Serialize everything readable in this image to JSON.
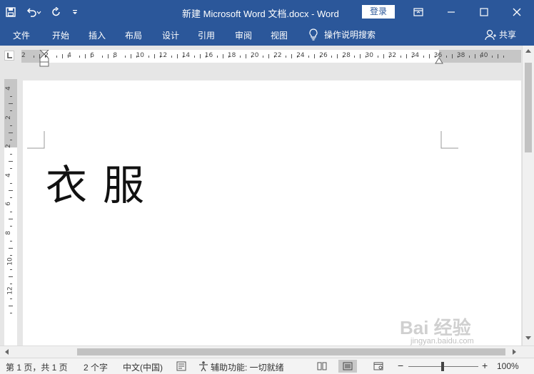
{
  "titlebar": {
    "title": "新建 Microsoft Word 文档.docx  -  Word",
    "login_label": "登录",
    "bg_color": "#2b579a"
  },
  "qat": {
    "icons": [
      "save-icon",
      "undo-icon",
      "redo-icon",
      "customize-qat-icon"
    ]
  },
  "ribbon": {
    "tabs": [
      "文件",
      "开始",
      "插入",
      "布局",
      "设计",
      "引用",
      "审阅",
      "视图"
    ],
    "tell_me": "操作说明搜索",
    "share": "共享"
  },
  "ruler": {
    "h_ticks": [
      "2",
      "2",
      "4",
      "6",
      "8",
      "10",
      "12",
      "14",
      "16",
      "18",
      "20",
      "22",
      "24",
      "26",
      "28",
      "30",
      "32",
      "34",
      "36",
      "38",
      "40"
    ],
    "v_ticks": [
      "4",
      "2",
      "2",
      "4",
      "6",
      "8",
      "10",
      "12"
    ]
  },
  "document": {
    "text": "衣服"
  },
  "statusbar": {
    "page": "第 1 页，共 1 页",
    "words": "2 个字",
    "language": "中文(中国)",
    "accessibility": "辅助功能: 一切就绪",
    "zoom_minus": "−",
    "zoom_plus": "+",
    "zoom_level": "100%"
  },
  "watermark": {
    "main": "Bai 经验",
    "sub": "jingyan.baidu.com"
  }
}
